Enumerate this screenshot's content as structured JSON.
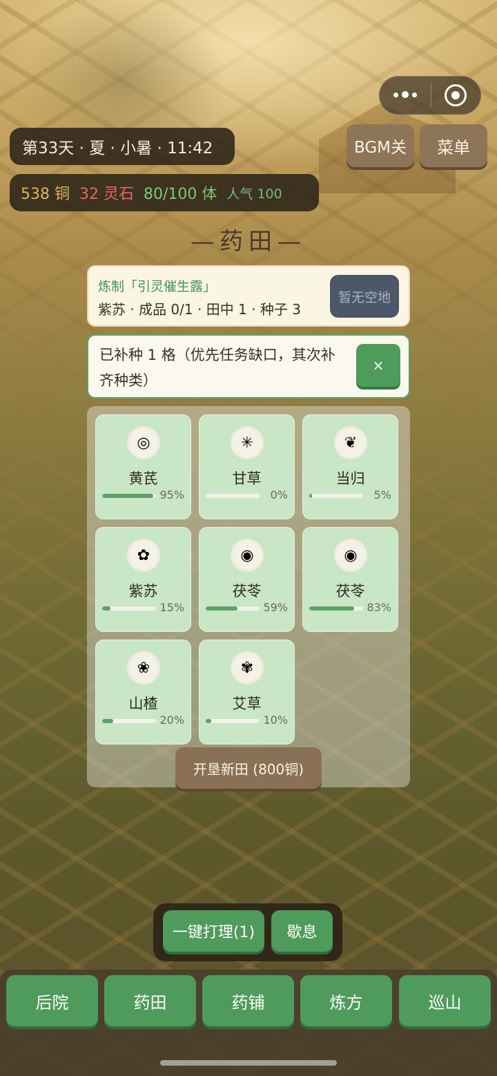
{
  "status": {
    "date": "第33天 · 夏 · 小暑 · 11:42",
    "copper": "538 铜",
    "spirit_stone": "32 灵石",
    "stamina": "80/100 体",
    "popularity": "人气 100"
  },
  "top_buttons": {
    "bgm": "BGM关",
    "menu": "菜单"
  },
  "section_title": "—药田—",
  "task": {
    "title": "炼制「引灵催生露」",
    "detail": "紫苏 · 成品 0/1 · 田中 1 · 种子 3",
    "button": "暂无空地"
  },
  "toast": {
    "message": "已补种 1 格（优先任务缺口，其次补齐种类）",
    "close": "×"
  },
  "plots": [
    {
      "name": "黄芪",
      "progress": 95,
      "progress_label": "95%",
      "icon": "astragalus-icon"
    },
    {
      "name": "甘草",
      "progress": 0,
      "progress_label": "0%",
      "icon": "licorice-icon"
    },
    {
      "name": "当归",
      "progress": 5,
      "progress_label": "5%",
      "icon": "angelica-icon"
    },
    {
      "name": "紫苏",
      "progress": 15,
      "progress_label": "15%",
      "icon": "perilla-icon"
    },
    {
      "name": "茯苓",
      "progress": 59,
      "progress_label": "59%",
      "icon": "poria-icon"
    },
    {
      "name": "茯苓",
      "progress": 83,
      "progress_label": "83%",
      "icon": "poria-icon"
    },
    {
      "name": "山楂",
      "progress": 20,
      "progress_label": "20%",
      "icon": "hawthorn-icon"
    },
    {
      "name": "艾草",
      "progress": 10,
      "progress_label": "10%",
      "icon": "mugwort-icon"
    }
  ],
  "expand_button": "开垦新田 (800铜)",
  "actions": {
    "tend_all": "一键打理(1)",
    "rest": "歇息"
  },
  "nav": [
    "后院",
    "药田",
    "药铺",
    "炼方",
    "巡山"
  ],
  "colors": {
    "accent_green": "#4e9b5b",
    "copper": "#e2b35a",
    "spirit_stone": "#e46a64",
    "stamina": "#7cc876"
  }
}
